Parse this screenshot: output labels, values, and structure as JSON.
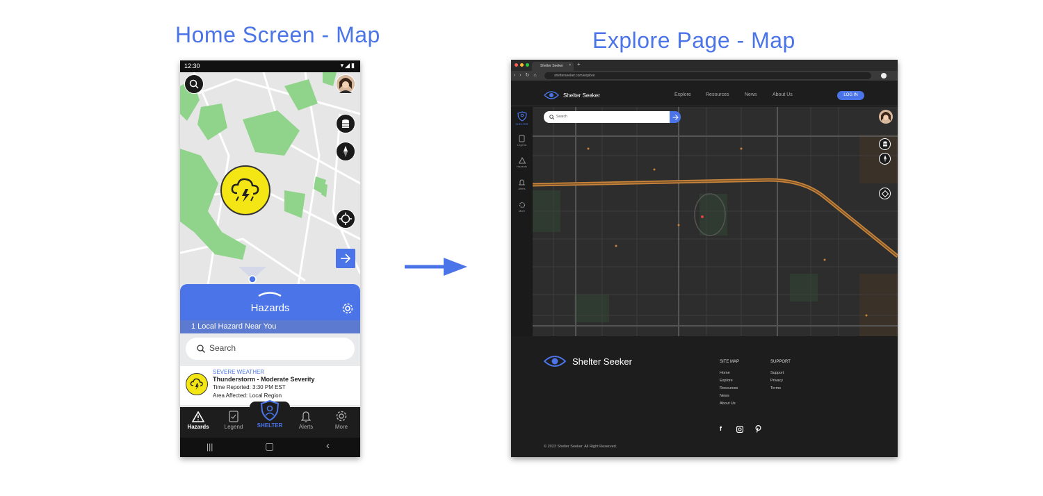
{
  "headings": {
    "left": "Home Screen - Map",
    "right": "Explore Page - Map"
  },
  "phone": {
    "status_time": "12:30",
    "panel": {
      "title": "Hazards",
      "local_count": "1 Local Hazard Near You",
      "search_placeholder": "Search"
    },
    "hazard_card": {
      "category": "SEVERE WEATHER",
      "title": "Thunderstorm - Moderate Severity",
      "time": "Time Reported: 3:30 PM EST",
      "area": "Area Affected: Local Region"
    },
    "nav": [
      {
        "label": "Hazards",
        "icon": "warning-icon"
      },
      {
        "label": "Legend",
        "icon": "legend-icon"
      },
      {
        "label": "SHELTER",
        "icon": "shelter-shield-icon"
      },
      {
        "label": "Alerts",
        "icon": "bell-icon"
      },
      {
        "label": "More",
        "icon": "gear-icon"
      }
    ],
    "colors": {
      "accent": "#4a74e8",
      "hazard_yellow": "#f3e614",
      "nav_bg": "#1d1d1d"
    }
  },
  "browser": {
    "tab_title": "Shelter Seeker",
    "url": "shelterseeker.com/explore",
    "site": {
      "brand": "Shelter Seeker",
      "nav": [
        "Explore",
        "Resources",
        "News",
        "About Us"
      ],
      "login": "LOG IN",
      "rail": [
        "SHELTER",
        "Legend",
        "Hazards",
        "Alerts",
        "More"
      ],
      "map_search_placeholder": "Search"
    },
    "footer": {
      "brand": "Shelter Seeker",
      "sitemap_title": "SITE MAP",
      "sitemap_links": [
        "Home",
        "Explore",
        "Resources",
        "News",
        "About Us"
      ],
      "support_title": "SUPPORT",
      "support_links": [
        "Support",
        "Privacy",
        "Terms"
      ],
      "copyright": "© 2023 Shelter Seeker. All Right Reserved."
    }
  }
}
